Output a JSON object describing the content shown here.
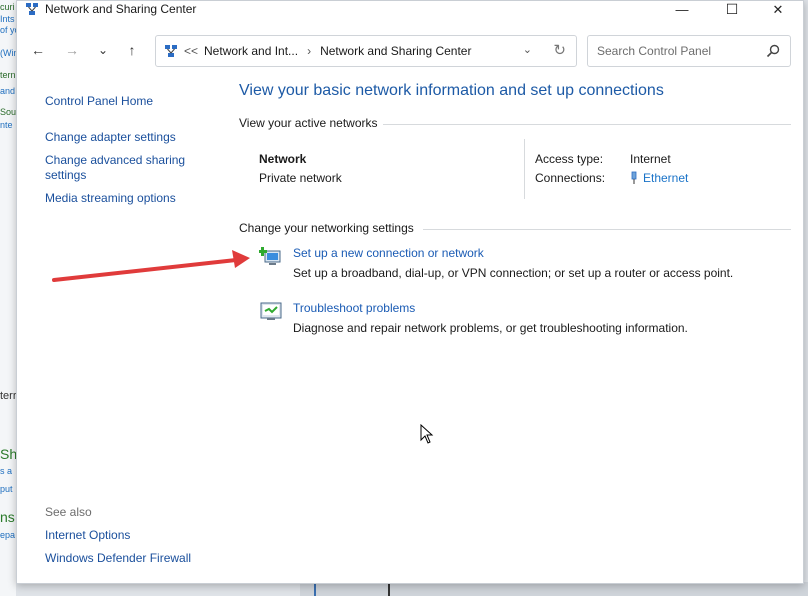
{
  "window": {
    "title": "Network and Sharing Center",
    "minimize": "—",
    "maximize": "☐",
    "close": "✕"
  },
  "nav": {
    "back": "←",
    "forward": "→",
    "recent": "⌄",
    "up": "↑",
    "address": {
      "overflow": "<<",
      "crumb1": "Network and Int...",
      "chevron": "›",
      "crumb2": "Network and Sharing Center",
      "dropdown": "⌄",
      "refresh": "↻"
    },
    "search_placeholder": "Search Control Panel"
  },
  "sidebar": {
    "home": "Control Panel Home",
    "links": [
      "Change adapter settings",
      "Change advanced sharing settings",
      "Media streaming options"
    ],
    "see_also_label": "See also",
    "see_also": [
      "Internet Options",
      "Windows Defender Firewall"
    ]
  },
  "main": {
    "heading": "View your basic network information and set up connections",
    "active_networks_label": "View your active networks",
    "network": {
      "name": "Network",
      "type": "Private network",
      "access_type_label": "Access type:",
      "access_type_value": "Internet",
      "connections_label": "Connections:",
      "connection_name": "Ethernet"
    },
    "change_settings_label": "Change your networking settings",
    "tasks": [
      {
        "icon": "new-connection-icon",
        "link": "Set up a new connection or network",
        "desc": "Set up a broadband, dial-up, or VPN connection; or set up a router or access point."
      },
      {
        "icon": "troubleshoot-icon",
        "link": "Troubleshoot problems",
        "desc": "Diagnose and repair network problems, or get troubleshooting information."
      }
    ]
  },
  "annotation": {
    "color": "#e03b3b"
  },
  "colors": {
    "link": "#1a5bb4",
    "heading": "#1d5aa6"
  },
  "background_app": {
    "fragments": [
      "curi",
      "Ints",
      "of yo",
      "(Win",
      "tern",
      "and",
      "Sou",
      "nte",
      "terr",
      "Sha",
      "s a",
      "put",
      "ns",
      "epa"
    ]
  }
}
